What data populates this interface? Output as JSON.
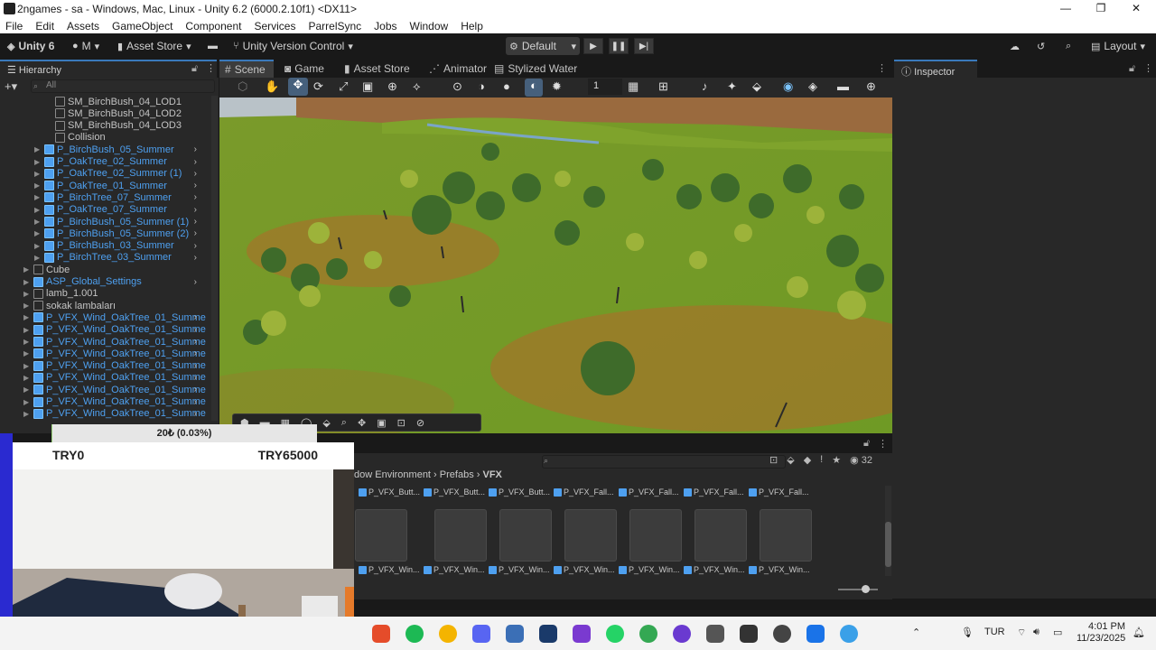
{
  "window": {
    "title": "2ngames - sa - Windows, Mac, Linux - Unity 6.2 (6000.2.10f1) <DX11>"
  },
  "menu": [
    "File",
    "Edit",
    "Assets",
    "GameObject",
    "Component",
    "Services",
    "ParrelSync",
    "Jobs",
    "Window",
    "Help"
  ],
  "toolbar": {
    "account": "Unity 6",
    "user": "M",
    "asset_store": "Asset Store",
    "version_control": "Unity Version Control",
    "layout_preset": "Default",
    "layout": "Layout"
  },
  "hierarchy": {
    "tab": "Hierarchy",
    "search_placeholder": "All",
    "items": [
      {
        "label": "SM_BirchBush_04_LOD1",
        "kind": "mesh"
      },
      {
        "label": "SM_BirchBush_04_LOD2",
        "kind": "mesh"
      },
      {
        "label": "SM_BirchBush_04_LOD3",
        "kind": "mesh"
      },
      {
        "label": "Collision",
        "kind": "mesh"
      },
      {
        "label": "P_BirchBush_05_Summer",
        "kind": "prefab"
      },
      {
        "label": "P_OakTree_02_Summer",
        "kind": "prefab"
      },
      {
        "label": "P_OakTree_02_Summer (1)",
        "kind": "prefab"
      },
      {
        "label": "P_OakTree_01_Summer",
        "kind": "prefab"
      },
      {
        "label": "P_BirchTree_07_Summer",
        "kind": "prefab"
      },
      {
        "label": "P_OakTree_07_Summer",
        "kind": "prefab"
      },
      {
        "label": "P_BirchBush_05_Summer (1)",
        "kind": "prefab"
      },
      {
        "label": "P_BirchBush_05_Summer (2)",
        "kind": "prefab"
      },
      {
        "label": "P_BirchBush_03_Summer",
        "kind": "prefab"
      },
      {
        "label": "P_BirchTree_03_Summer",
        "kind": "prefab"
      },
      {
        "label": "Cube",
        "kind": "object"
      },
      {
        "label": "ASP_Global_Settings",
        "kind": "prefab"
      },
      {
        "label": "lamb_1.001",
        "kind": "object"
      },
      {
        "label": "sokak lambaları",
        "kind": "object"
      },
      {
        "label": "P_VFX_Wind_OakTree_01_Summe",
        "kind": "prefab"
      },
      {
        "label": "P_VFX_Wind_OakTree_01_Summe",
        "kind": "prefab"
      },
      {
        "label": "P_VFX_Wind_OakTree_01_Summe",
        "kind": "prefab"
      },
      {
        "label": "P_VFX_Wind_OakTree_01_Summe",
        "kind": "prefab"
      },
      {
        "label": "P_VFX_Wind_OakTree_01_Summe",
        "kind": "prefab"
      },
      {
        "label": "P_VFX_Wind_OakTree_01_Summe",
        "kind": "prefab"
      },
      {
        "label": "P_VFX_Wind_OakTree_01_Summe",
        "kind": "prefab"
      },
      {
        "label": "P_VFX_Wind_OakTree_01_Summe",
        "kind": "prefab"
      },
      {
        "label": "P_VFX_Wind_OakTree_01_Summe",
        "kind": "prefab"
      }
    ]
  },
  "scene": {
    "tabs": [
      "Scene",
      "Game",
      "Asset Store",
      "Animator",
      "Stylized Water"
    ],
    "grid_value": "1"
  },
  "inspector": {
    "tab": "Inspector"
  },
  "project": {
    "breadcrumb": [
      "dow Environment",
      "Prefabs",
      "VFX"
    ],
    "count": "32",
    "top_labels": [
      "P_VFX_Butt...",
      "P_VFX_Butt...",
      "P_VFX_Butt...",
      "P_VFX_Fall...",
      "P_VFX_Fall...",
      "P_VFX_Fall...",
      "P_VFX_Fall..."
    ],
    "bottom_labels": [
      "P_VFX_Win...",
      "P_VFX_Win...",
      "P_VFX_Win...",
      "P_VFX_Win...",
      "P_VFX_Win...",
      "P_VFX_Win...",
      "P_VFX_Win..."
    ]
  },
  "donation_overlay": {
    "progress_text": "20₺ (0.03%)",
    "left": "TRY0",
    "right": "TRY65000",
    "progress_fraction": 0.0003
  },
  "taskbar": {
    "language": "TUR",
    "time": "4:01 PM",
    "date": "11/23/2025"
  }
}
